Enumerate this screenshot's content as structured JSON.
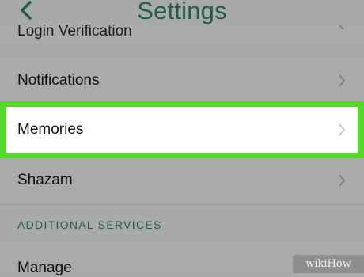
{
  "header": {
    "title": "Settings"
  },
  "rows": {
    "login_verification": "Login Verification",
    "notifications": "Notifications",
    "memories": "Memories",
    "shazam": "Shazam",
    "manage": "Manage"
  },
  "section": {
    "additional_services": "ADDITIONAL SERVICES"
  },
  "watermark": "wikiHow",
  "colors": {
    "accent": "#235c49",
    "highlight": "#53d828",
    "background": "#a8aaaa"
  },
  "icons": {
    "back": "chevron-left-icon",
    "row": "chevron-right-icon"
  }
}
